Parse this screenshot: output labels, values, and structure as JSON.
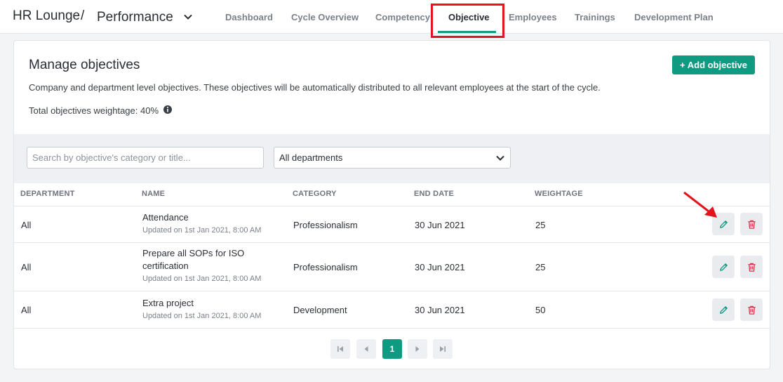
{
  "breadcrumb": {
    "app": "HR Lounge",
    "separator": "/",
    "page": "Performance"
  },
  "nav": {
    "tabs": [
      {
        "label": "Dashboard"
      },
      {
        "label": "Cycle Overview"
      },
      {
        "label": "Competency"
      },
      {
        "label": "Objective"
      },
      {
        "label": "Employees"
      },
      {
        "label": "Trainings"
      },
      {
        "label": "Development Plan"
      }
    ],
    "active": "Objective"
  },
  "header": {
    "title": "Manage objectives",
    "description": "Company and department level objectives. These objectives will be automatically distributed to all relevant employees at the start of the cycle.",
    "total_weightage": "Total objectives weightage: 40%",
    "add_button": "+ Add objective"
  },
  "filters": {
    "search_placeholder": "Search by objective's category or title...",
    "department_value": "All departments"
  },
  "table": {
    "headers": [
      "DEPARTMENT",
      "NAME",
      "CATEGORY",
      "END DATE",
      "WEIGHTAGE"
    ],
    "rows": [
      {
        "department": "All",
        "name": "Attendance",
        "updated": "Updated on 1st Jan 2021, 8:00 AM",
        "category": "Professionalism",
        "end_date": "30 Jun 2021",
        "weightage": "25"
      },
      {
        "department": "All",
        "name": "Prepare all SOPs for ISO certification",
        "updated": "Updated on 1st Jan 2021, 8:00 AM",
        "category": "Professionalism",
        "end_date": "30 Jun 2021",
        "weightage": "25"
      },
      {
        "department": "All",
        "name": "Extra project",
        "updated": "Updated on 1st Jan 2021, 8:00 AM",
        "category": "Development",
        "end_date": "30 Jun 2021",
        "weightage": "50"
      }
    ]
  },
  "pagination": {
    "current_page": "1"
  },
  "colors": {
    "accent": "#0f9b82",
    "danger": "#d9344a",
    "annotation": "#e3141b"
  },
  "icons": [
    "chevron-down-icon",
    "info-icon",
    "pencil-icon",
    "trash-icon",
    "first-page-icon",
    "prev-page-icon",
    "next-page-icon",
    "last-page-icon",
    "annotation-arrow-icon"
  ]
}
